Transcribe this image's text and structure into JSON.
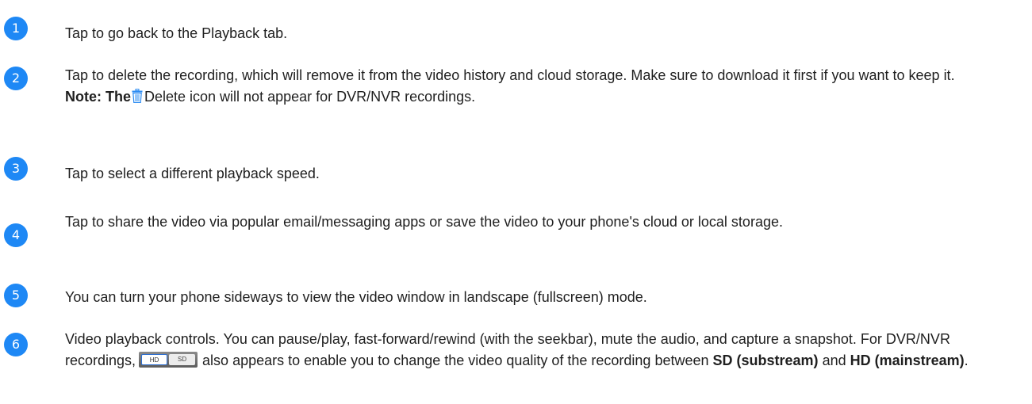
{
  "accent_color": "#1e88f5",
  "steps": [
    {
      "number": "1",
      "text": "Tap to go back to the Playback tab."
    },
    {
      "number": "2",
      "text": "Tap to delete the recording, which will remove it from the video history and cloud storage. Make sure to download it first if you want to keep it.",
      "note_label": "Note: The",
      "note_icon": "trash-icon",
      "note_text": "Delete icon will not appear for DVR/NVR recordings."
    },
    {
      "number": "3",
      "text": "Tap to select a different playback speed."
    },
    {
      "number": "4",
      "text": "Tap to share the video via popular email/messaging apps or save the video to your phone's cloud or local storage."
    },
    {
      "number": "5",
      "text": "You can turn your phone sideways to view the video window in landscape (fullscreen) mode."
    },
    {
      "number": "6",
      "text_part1": "Video playback controls. You can pause/play, fast-forward/rewind (with the seekbar), mute the audio, and capture a snapshot. For DVR/NVR recordings,",
      "toggle": {
        "hd_label": "HD",
        "sd_label": "SD"
      },
      "text_part2": "also appears to enable you to change the video quality of the recording between",
      "sd_term": "SD (substream)",
      "and_word": "and",
      "hd_term": "HD (mainstream)",
      "end_period": "."
    }
  ]
}
